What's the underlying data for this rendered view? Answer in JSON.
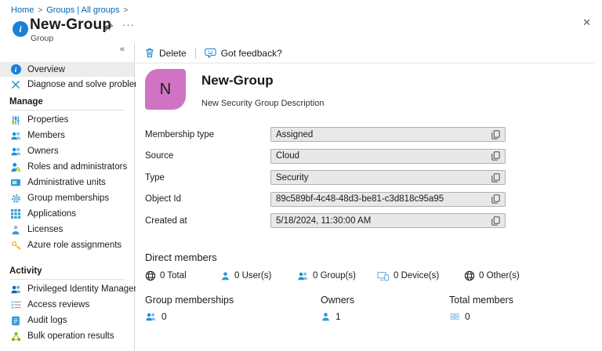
{
  "window": {
    "close_icon": "✕"
  },
  "breadcrumb": {
    "items": [
      {
        "label": "Home"
      },
      {
        "label": "Groups | All groups"
      }
    ],
    "separator": ">"
  },
  "header": {
    "title": "New-Group",
    "subtitle": "Group",
    "ellipsis_icon": "···"
  },
  "sidebar": {
    "collapse_icon": "«",
    "top_items": [
      {
        "label": "Overview"
      },
      {
        "label": "Diagnose and solve problems"
      }
    ],
    "manage": {
      "header": "Manage",
      "items": [
        {
          "label": "Properties"
        },
        {
          "label": "Members"
        },
        {
          "label": "Owners"
        },
        {
          "label": "Roles and administrators"
        },
        {
          "label": "Administrative units"
        },
        {
          "label": "Group memberships"
        },
        {
          "label": "Applications"
        },
        {
          "label": "Licenses"
        },
        {
          "label": "Azure role assignments"
        }
      ]
    },
    "activity": {
      "header": "Activity",
      "items": [
        {
          "label": "Privileged Identity Management"
        },
        {
          "label": "Access reviews"
        },
        {
          "label": "Audit logs"
        },
        {
          "label": "Bulk operation results"
        }
      ]
    }
  },
  "toolbar": {
    "delete_label": "Delete",
    "feedback_label": "Got feedback?"
  },
  "group": {
    "name": "New-Group",
    "description": "New Security Group Description",
    "avatar_letter": "N",
    "avatar_color": "#d173c3"
  },
  "fields": [
    {
      "label": "Membership type",
      "value": "Assigned"
    },
    {
      "label": "Source",
      "value": "Cloud"
    },
    {
      "label": "Type",
      "value": "Security"
    },
    {
      "label": "Object Id",
      "value": "89c589bf-4c48-48d3-be81-c3d818c95a95"
    },
    {
      "label": "Created at",
      "value": "5/18/2024, 11:30:00 AM"
    }
  ],
  "direct_members": {
    "title": "Direct members",
    "stats": [
      {
        "icon": "globe-icon",
        "label": "0 Total"
      },
      {
        "icon": "user-icon",
        "label": "0 User(s)"
      },
      {
        "icon": "group-icon",
        "label": "0 Group(s)"
      },
      {
        "icon": "device-icon",
        "label": "0 Device(s)"
      },
      {
        "icon": "globe-icon",
        "label": "0 Other(s)"
      }
    ]
  },
  "summary": [
    {
      "title": "Group memberships",
      "count": "0",
      "icon": "group-icon"
    },
    {
      "title": "Owners",
      "count": "1",
      "icon": "user-icon"
    },
    {
      "title": "Total members",
      "count": "0",
      "icon": "atom-icon"
    }
  ],
  "colors": {
    "accent_blue": "#0078d4",
    "link_blue": "#0067b8",
    "avatar_pink": "#d173c3"
  }
}
